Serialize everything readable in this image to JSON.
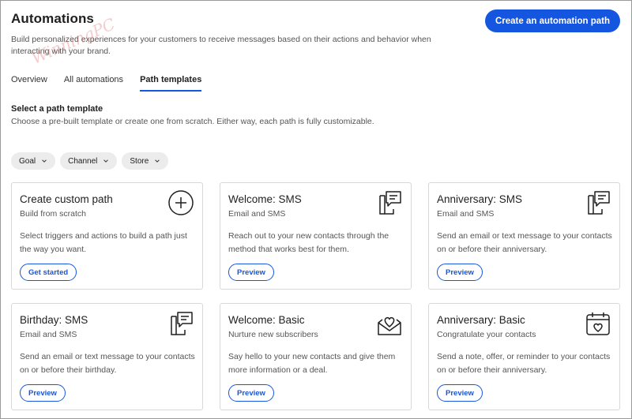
{
  "header": {
    "title": "Automations",
    "description": "Build personalized experiences for your customers to receive messages based on their actions and behavior when interacting with your brand.",
    "create_button": "Create an automation path"
  },
  "watermark": "WinningPC",
  "tabs": [
    {
      "label": "Overview",
      "active": false
    },
    {
      "label": "All automations",
      "active": false
    },
    {
      "label": "Path templates",
      "active": true
    }
  ],
  "section": {
    "title": "Select a path template",
    "subtitle": "Choose a pre-built template or create one from scratch. Either way, each path is fully customizable."
  },
  "filters": [
    "Goal",
    "Channel",
    "Store"
  ],
  "cards": [
    {
      "title": "Create custom path",
      "subtitle": "Build from scratch",
      "body": "Select triggers and actions to build a path just the way you want.",
      "button": "Get started",
      "icon": "plus-circle-icon"
    },
    {
      "title": "Welcome: SMS",
      "subtitle": "Email and SMS",
      "body": "Reach out to your new contacts through the method that works best for them.",
      "button": "Preview",
      "icon": "sms-phone-icon"
    },
    {
      "title": "Anniversary: SMS",
      "subtitle": "Email and SMS",
      "body": "Send an email or text message to your contacts on or before their anniversary.",
      "button": "Preview",
      "icon": "sms-phone-icon"
    },
    {
      "title": "Birthday: SMS",
      "subtitle": "Email and SMS",
      "body": "Send an email or text message to your contacts on or before their birthday.",
      "button": "Preview",
      "icon": "sms-phone-icon"
    },
    {
      "title": "Welcome: Basic",
      "subtitle": "Nurture new subscribers",
      "body": "Say hello to your new contacts and give them more information or a deal.",
      "button": "Preview",
      "icon": "heart-envelope-icon"
    },
    {
      "title": "Anniversary: Basic",
      "subtitle": "Congratulate your contacts",
      "body": "Send a note, offer, or reminder to your contacts on or before their anniversary.",
      "button": "Preview",
      "icon": "heart-calendar-icon"
    }
  ],
  "colors": {
    "accent": "#1556e0",
    "chip_bg": "#ececec",
    "card_border": "#d8d8d8"
  }
}
